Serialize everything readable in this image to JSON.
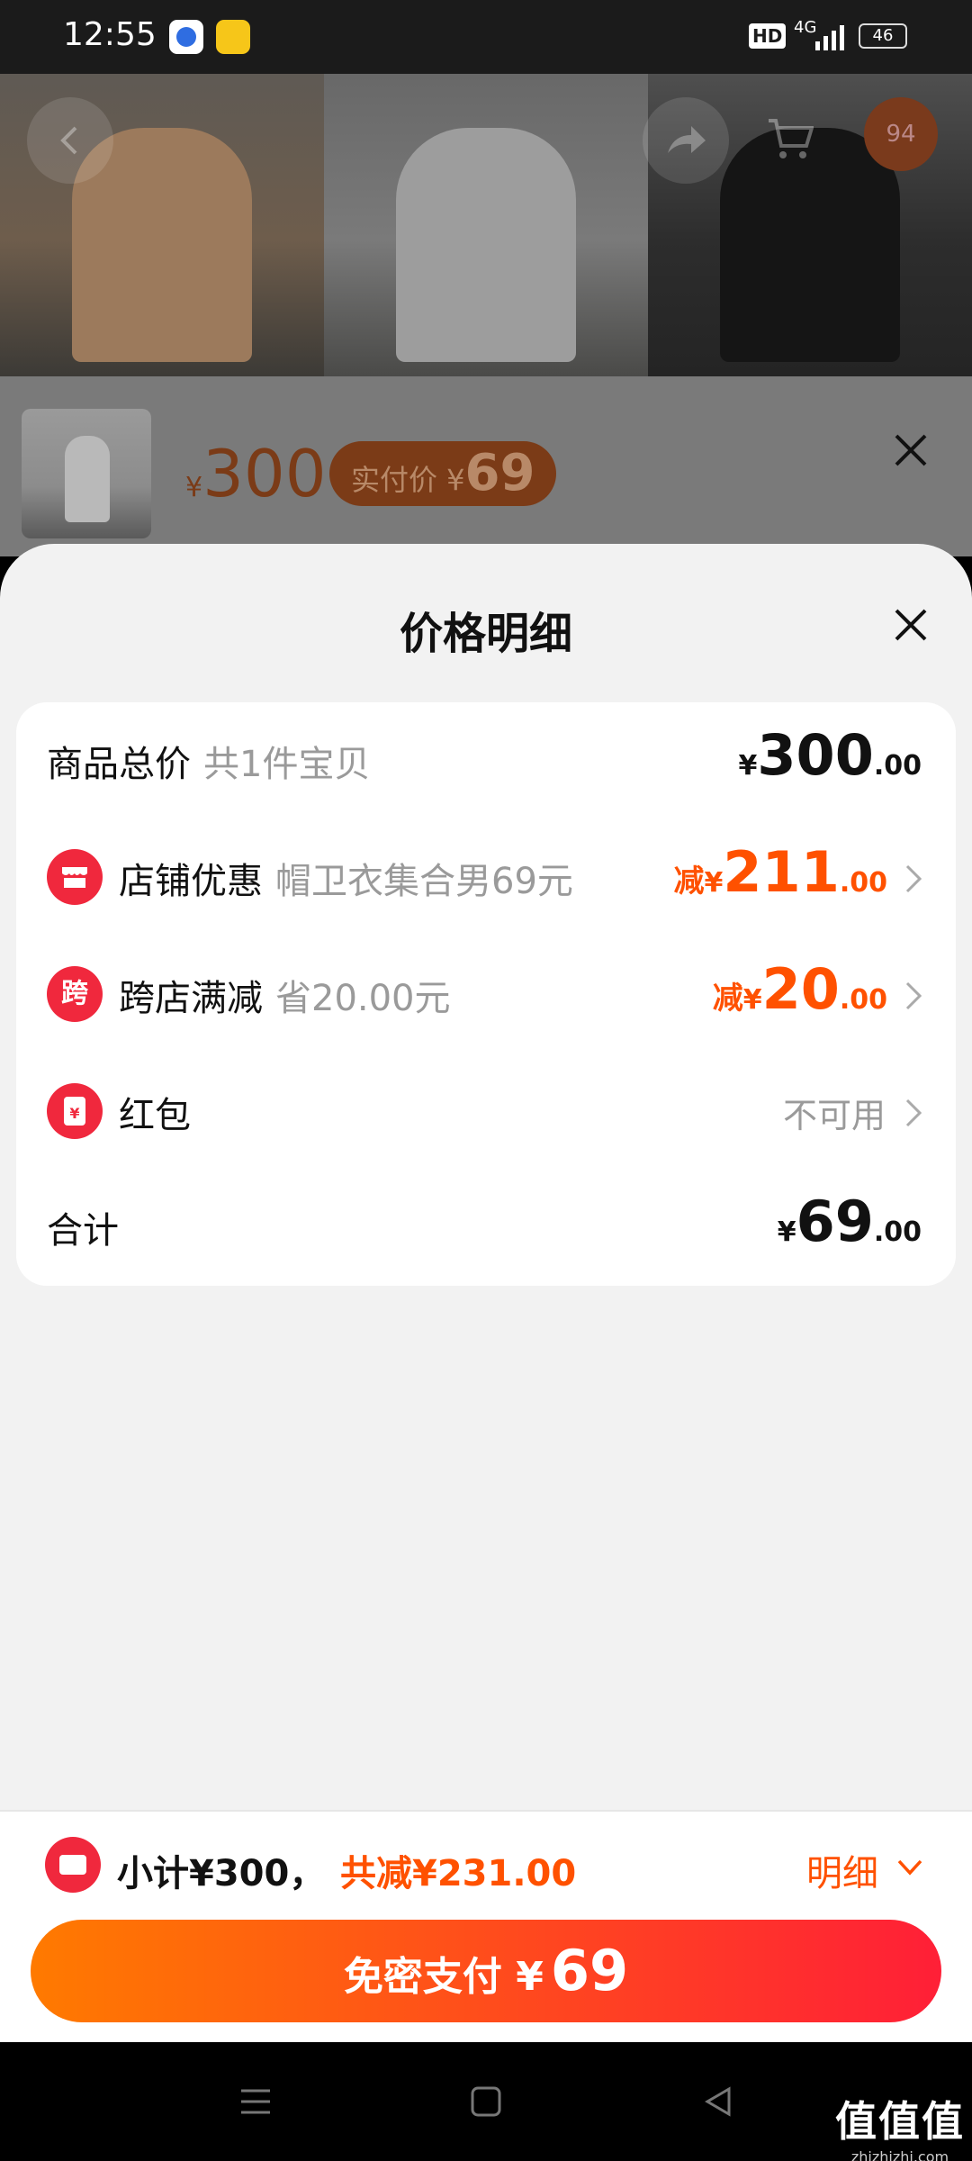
{
  "status_bar": {
    "time": "12:55",
    "hd": "HD",
    "network": "4G",
    "battery": "46"
  },
  "hero": {
    "cart_badge": "94"
  },
  "overlay_product": {
    "currency": "¥",
    "original_price": "300",
    "paid_label": "实付价 ¥",
    "paid_price": "69"
  },
  "sheet": {
    "title": "价格明细",
    "rows": {
      "total": {
        "label": "商品总价",
        "sub": "共1件宝贝",
        "yen": "¥",
        "amount_int": "300",
        "amount_dec": ".00"
      },
      "shop_discount": {
        "label": "店铺优惠",
        "sub": "帽卫衣集合男69元",
        "minus": "减",
        "yen": "¥",
        "amount_int": "211",
        "amount_dec": ".00"
      },
      "cross_store": {
        "icon_text": "跨",
        "label": "跨店满减",
        "sub": "省20.00元",
        "minus": "减",
        "yen": "¥",
        "amount_int": "20",
        "amount_dec": ".00"
      },
      "red_packet": {
        "icon_text": "¥",
        "label": "红包",
        "status": "不可用"
      },
      "sum": {
        "label": "合计",
        "yen": "¥",
        "amount_int": "69",
        "amount_dec": ".00"
      }
    }
  },
  "footer": {
    "subtotal": "小计¥300，",
    "saved": "共减¥231.00",
    "detail_label": "明细",
    "pay_label": "免密支付 ¥",
    "pay_amount": "69"
  },
  "watermark": {
    "main": "值值值",
    "site": "zhizhizhi.com"
  },
  "colors": {
    "accent_orange": "#ff5100",
    "accent_red": "#f0283d",
    "button_gradient_start": "#ff7a00",
    "button_gradient_end": "#ff1f37"
  }
}
